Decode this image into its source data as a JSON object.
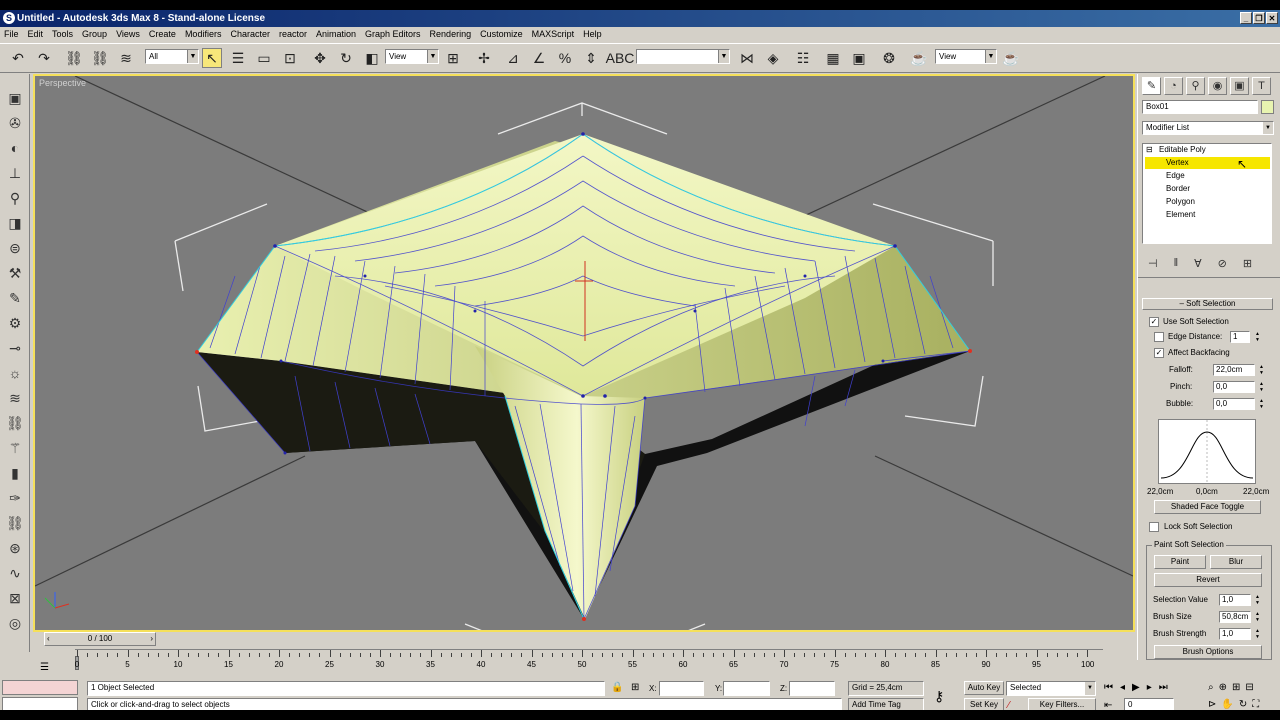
{
  "app": {
    "title": "Untitled - Autodesk 3ds Max 8 - Stand-alone License"
  },
  "menu": [
    "File",
    "Edit",
    "Tools",
    "Group",
    "Views",
    "Create",
    "Modifiers",
    "Character",
    "reactor",
    "Animation",
    "Graph Editors",
    "Rendering",
    "Customize",
    "MAXScript",
    "Help"
  ],
  "toolbar": {
    "filter_value": "All",
    "refcoord_value": "View",
    "named_sel_value": "",
    "render_view_value": "View"
  },
  "viewport": {
    "label": "Perspective"
  },
  "panel": {
    "object_name": "Box01",
    "modifier_list": "Modifier List",
    "stack": {
      "base": "Editable Poly",
      "items": [
        "Vertex",
        "Edge",
        "Border",
        "Polygon",
        "Element"
      ],
      "selected": "Vertex"
    },
    "soft_selection": {
      "title": "Soft Selection",
      "use_soft_selection": "Use Soft Selection",
      "edge_distance": "Edge Distance:",
      "edge_distance_value": "1",
      "affect_backfacing": "Affect Backfacing",
      "falloff_label": "Falloff:",
      "falloff_value": "22,0cm",
      "pinch_label": "Pinch:",
      "pinch_value": "0,0",
      "bubble_label": "Bubble:",
      "bubble_value": "0,0",
      "curve_left": "22,0cm",
      "curve_mid": "0,0cm",
      "curve_right": "22,0cm",
      "shaded_face_toggle": "Shaded Face Toggle",
      "lock_soft_selection": "Lock Soft Selection",
      "paint_group": "Paint Soft Selection",
      "paint": "Paint",
      "blur": "Blur",
      "revert": "Revert",
      "selection_value_label": "Selection Value",
      "selection_value": "1,0",
      "brush_size_label": "Brush Size",
      "brush_size": "50,8cm",
      "brush_strength_label": "Brush Strength",
      "brush_strength": "1,0",
      "brush_options": "Brush Options"
    }
  },
  "timeline": {
    "slider": "0 / 100",
    "ticks": [
      "0",
      "5",
      "10",
      "15",
      "20",
      "25",
      "30",
      "35",
      "40",
      "45",
      "50",
      "55",
      "60",
      "65",
      "70",
      "75",
      "80",
      "85",
      "90",
      "95",
      "100"
    ]
  },
  "status": {
    "objects": "1 Object Selected",
    "prompt": "Click or click-and-drag to select objects",
    "x_label": "X:",
    "y_label": "Y:",
    "z_label": "Z:",
    "grid": "Grid = 25,4cm",
    "add_time_tag": "Add Time Tag",
    "auto_key": "Auto Key",
    "set_key": "Set Key",
    "selected": "Selected",
    "key_filters": "Key Filters...",
    "frame": "0"
  }
}
